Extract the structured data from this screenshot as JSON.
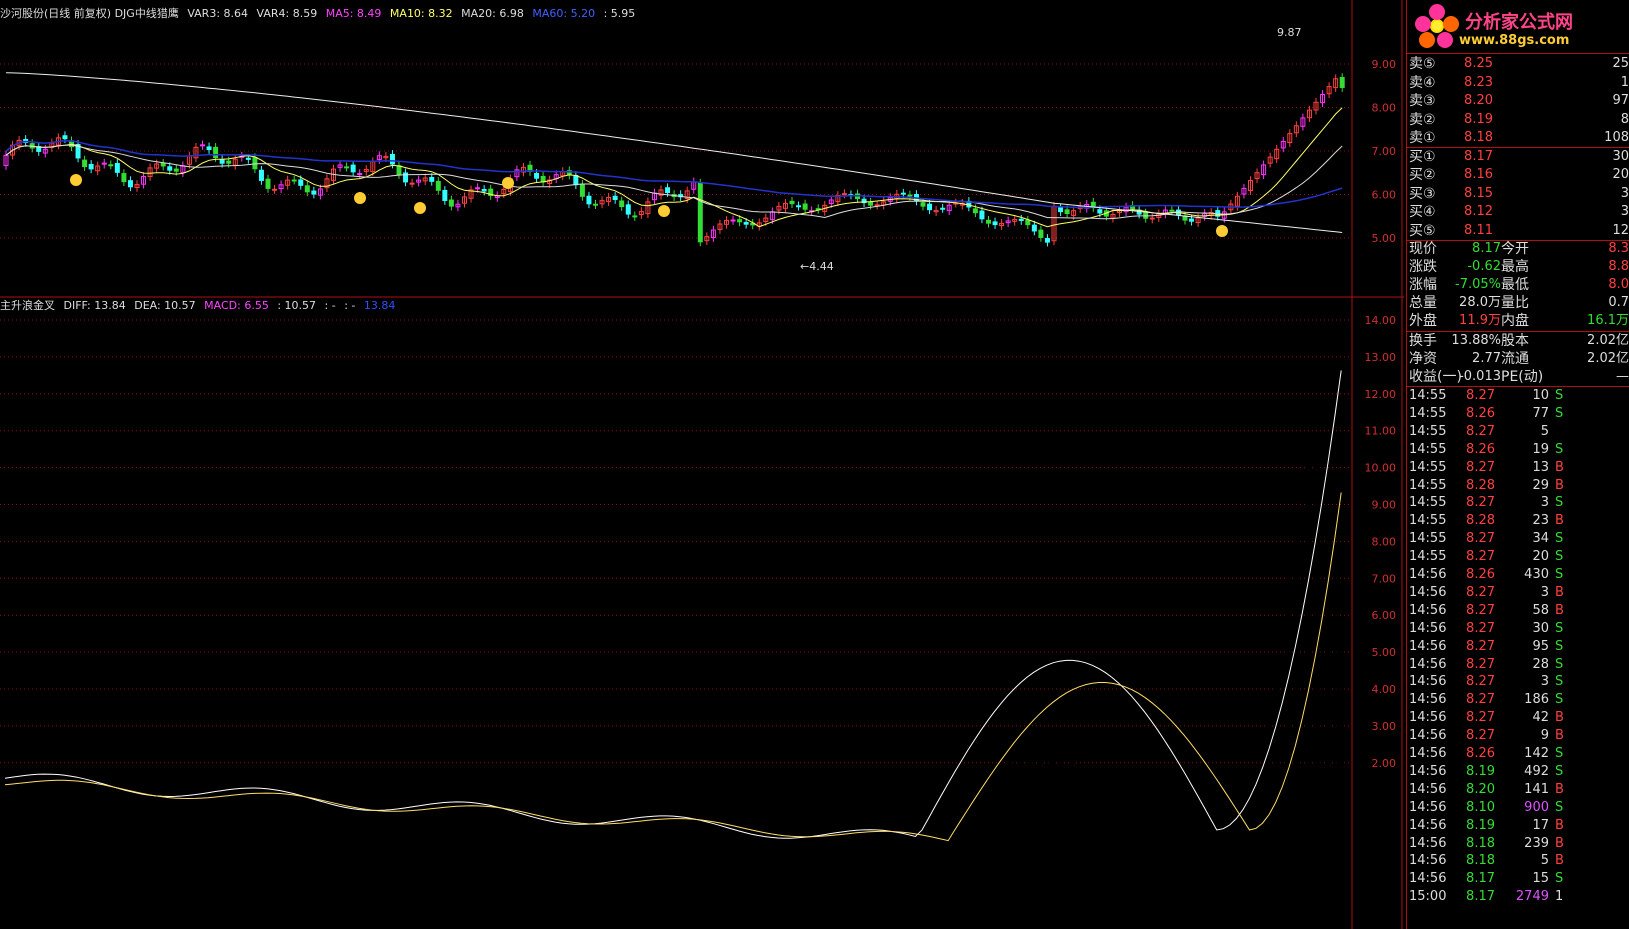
{
  "top_header": {
    "title": "沙河股份(日线 前复权) DJG中线猎鹰",
    "var3": "VAR3: 8.64",
    "var4": "VAR4: 8.59",
    "ma5": "MA5: 8.49",
    "ma10": "MA10: 8.32",
    "ma20": "MA20: 6.98",
    "ma60": "MA60: 5.20",
    "extra": ": 5.95"
  },
  "price_panel": {
    "ticks": [
      "9.00",
      "8.00",
      "7.00",
      "6.00",
      "5.00"
    ],
    "high_label": "9.87",
    "low_label": "←4.44"
  },
  "macd_header": {
    "title": "主升浪金叉",
    "diff": "DIFF: 13.84",
    "dea": "DEA: 10.57",
    "macd": "MACD: 6.55",
    "extra1": ": 10.57",
    "extra2": ": -",
    "extra3": ": -",
    "extra4": "13.84"
  },
  "macd_panel": {
    "ticks": [
      "14.00",
      "13.00",
      "12.00",
      "11.00",
      "10.00",
      "9.00",
      "8.00",
      "7.00",
      "6.00",
      "5.00",
      "4.00",
      "3.00",
      "2.00"
    ]
  },
  "logo": {
    "title": "分析家公式网",
    "url": "www.88gs.com"
  },
  "order_book": [
    {
      "label": "卖⑤",
      "price": "8.25",
      "vol": "25"
    },
    {
      "label": "卖④",
      "price": "8.23",
      "vol": "1"
    },
    {
      "label": "卖③",
      "price": "8.20",
      "vol": "97"
    },
    {
      "label": "卖②",
      "price": "8.19",
      "vol": "8"
    },
    {
      "label": "卖①",
      "price": "8.18",
      "vol": "108"
    },
    {
      "label": "买①",
      "price": "8.17",
      "vol": "30"
    },
    {
      "label": "买②",
      "price": "8.16",
      "vol": "20"
    },
    {
      "label": "买③",
      "price": "8.15",
      "vol": "3"
    },
    {
      "label": "买④",
      "price": "8.12",
      "vol": "3"
    },
    {
      "label": "买⑤",
      "price": "8.11",
      "vol": "12"
    }
  ],
  "quote": [
    {
      "l1": "现价",
      "v1": "8.17",
      "l2": "今开",
      "v2": "8.3"
    },
    {
      "l1": "涨跌",
      "v1": "-0.62",
      "l2": "最高",
      "v2": "8.8"
    },
    {
      "l1": "涨幅",
      "v1": "-7.05%",
      "l2": "最低",
      "v2": "8.0"
    },
    {
      "l1": "总量",
      "v1": "28.0万",
      "l2": "量比",
      "v2": "0.7"
    },
    {
      "l1": "外盘",
      "v1": "11.9万",
      "l2": "内盘",
      "v2": "16.1万"
    }
  ],
  "fund": [
    {
      "l1": "换手",
      "v1": "13.88%",
      "l2": "股本",
      "v2": "2.02亿"
    },
    {
      "l1": "净资",
      "v1": "2.77",
      "l2": "流通",
      "v2": "2.02亿"
    },
    {
      "l1": "收益(一)",
      "v1": "-0.013",
      "l2": "PE(动)",
      "v2": "—"
    }
  ],
  "ticks_list": [
    {
      "t": "14:55",
      "p": "8.27",
      "v": "10",
      "s": "S"
    },
    {
      "t": "14:55",
      "p": "8.26",
      "v": "77",
      "s": "S"
    },
    {
      "t": "14:55",
      "p": "8.27",
      "v": "5",
      "s": ""
    },
    {
      "t": "14:55",
      "p": "8.26",
      "v": "19",
      "s": "S"
    },
    {
      "t": "14:55",
      "p": "8.27",
      "v": "13",
      "s": "B"
    },
    {
      "t": "14:55",
      "p": "8.28",
      "v": "29",
      "s": "B"
    },
    {
      "t": "14:55",
      "p": "8.27",
      "v": "3",
      "s": "S"
    },
    {
      "t": "14:55",
      "p": "8.28",
      "v": "23",
      "s": "B"
    },
    {
      "t": "14:55",
      "p": "8.27",
      "v": "34",
      "s": "S"
    },
    {
      "t": "14:55",
      "p": "8.27",
      "v": "20",
      "s": "S"
    },
    {
      "t": "14:56",
      "p": "8.26",
      "v": "430",
      "s": "S"
    },
    {
      "t": "14:56",
      "p": "8.27",
      "v": "3",
      "s": "B"
    },
    {
      "t": "14:56",
      "p": "8.27",
      "v": "58",
      "s": "B"
    },
    {
      "t": "14:56",
      "p": "8.27",
      "v": "30",
      "s": "S"
    },
    {
      "t": "14:56",
      "p": "8.27",
      "v": "95",
      "s": "S"
    },
    {
      "t": "14:56",
      "p": "8.27",
      "v": "28",
      "s": "S"
    },
    {
      "t": "14:56",
      "p": "8.27",
      "v": "3",
      "s": "S"
    },
    {
      "t": "14:56",
      "p": "8.27",
      "v": "186",
      "s": "S"
    },
    {
      "t": "14:56",
      "p": "8.27",
      "v": "42",
      "s": "B"
    },
    {
      "t": "14:56",
      "p": "8.27",
      "v": "9",
      "s": "B"
    },
    {
      "t": "14:56",
      "p": "8.26",
      "v": "142",
      "s": "S"
    },
    {
      "t": "14:56",
      "p": "8.19",
      "v": "492",
      "s": "S"
    },
    {
      "t": "14:56",
      "p": "8.20",
      "v": "141",
      "s": "B"
    },
    {
      "t": "14:56",
      "p": "8.10",
      "v": "900",
      "s": "S"
    },
    {
      "t": "14:56",
      "p": "8.19",
      "v": "17",
      "s": "B"
    },
    {
      "t": "14:56",
      "p": "8.18",
      "v": "239",
      "s": "B"
    },
    {
      "t": "14:56",
      "p": "8.18",
      "v": "5",
      "s": "B"
    },
    {
      "t": "14:56",
      "p": "8.17",
      "v": "15",
      "s": "S"
    },
    {
      "t": "15:00",
      "p": "8.17",
      "v": "2749",
      "s": "1"
    }
  ],
  "colors": {
    "up": "#ff4040",
    "down": "#33dd33",
    "grid": "#8a1010",
    "magenta": "#ff33ff",
    "cyan": "#33ffff",
    "yellow": "#ffff88"
  }
}
